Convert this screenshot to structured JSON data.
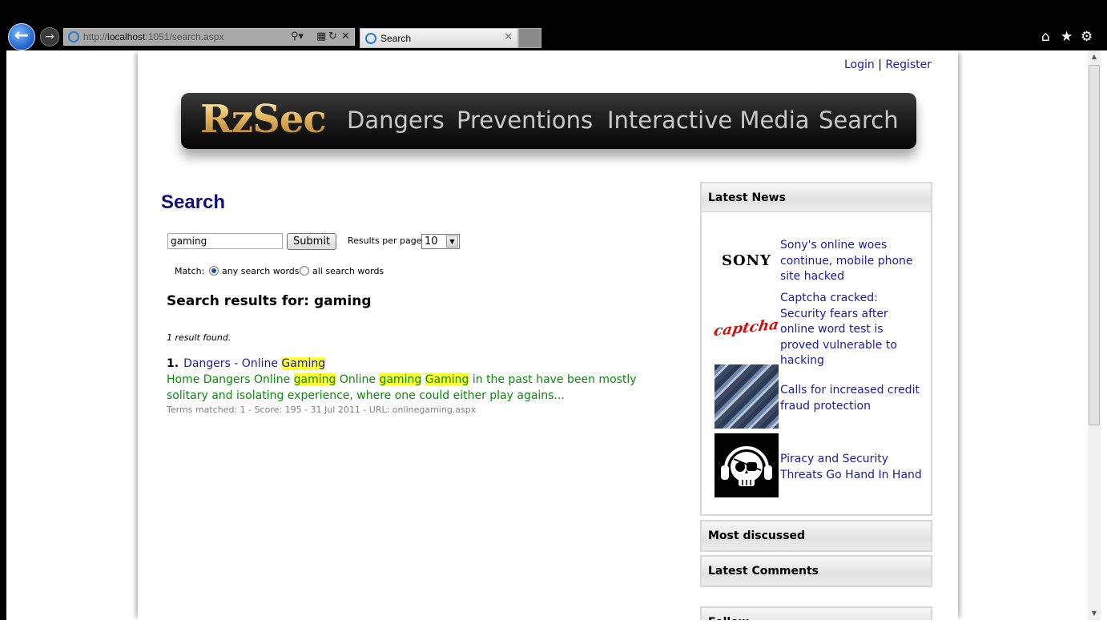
{
  "browser": {
    "url_prefix": "http://",
    "url_host": "localhost",
    "url_rest": ":1051/search.aspx",
    "tab_title": "Search"
  },
  "header": {
    "login": "Login",
    "separator": "|",
    "register": "Register"
  },
  "banner": {
    "logo": "RzSec",
    "nav": [
      "Dangers",
      "Preventions",
      "Interactive Media",
      "Search"
    ]
  },
  "search": {
    "heading": "Search",
    "query": "gaming",
    "submit_label": "Submit",
    "results_per_page_label": "Results per page:",
    "results_per_page_value": "10",
    "match_label": "Match:",
    "match_any": "any search words",
    "match_all": "all search words",
    "results_for_prefix": "Search results for: ",
    "results_for_query": "gaming",
    "found_text": "1 result found."
  },
  "result": {
    "number": "1.",
    "title_prefix": "Dangers - Online ",
    "title_highlight": "Gaming",
    "snippet_1": "Home Dangers Online ",
    "snippet_hl1": "gaming",
    "snippet_2": " Online ",
    "snippet_hl2": "gaming",
    "snippet_3": " ",
    "snippet_hl3": "Gaming",
    "snippet_4": " in the past have been mostly solitary and isolating experience, where one could either play agains...",
    "meta": "Terms matched: 1  -  Score: 195  -  31 Jul 2011  -  URL: onlinegaming.aspx"
  },
  "sidebar": {
    "latest_news_title": "Latest News",
    "news": [
      {
        "thumb_text": "SONY",
        "title": "Sony's online woes continue, mobile phone site hacked"
      },
      {
        "thumb_text": "captcha",
        "title": "Captcha cracked: Security fears after online word test is proved vulnerable to hacking"
      },
      {
        "thumb_text": "",
        "title": "Calls for increased credit fraud protection"
      },
      {
        "thumb_text": "",
        "title": "Piracy and Security Threats Go Hand In Hand"
      }
    ],
    "most_discussed_title": "Most discussed",
    "latest_comments_title": "Latest Comments",
    "partial_panel_title": "Follow"
  },
  "colors": {
    "link": "#1a1aa6",
    "heading": "#10107a",
    "snippet": "#0a8a0a",
    "highlight": "#ffff33"
  }
}
